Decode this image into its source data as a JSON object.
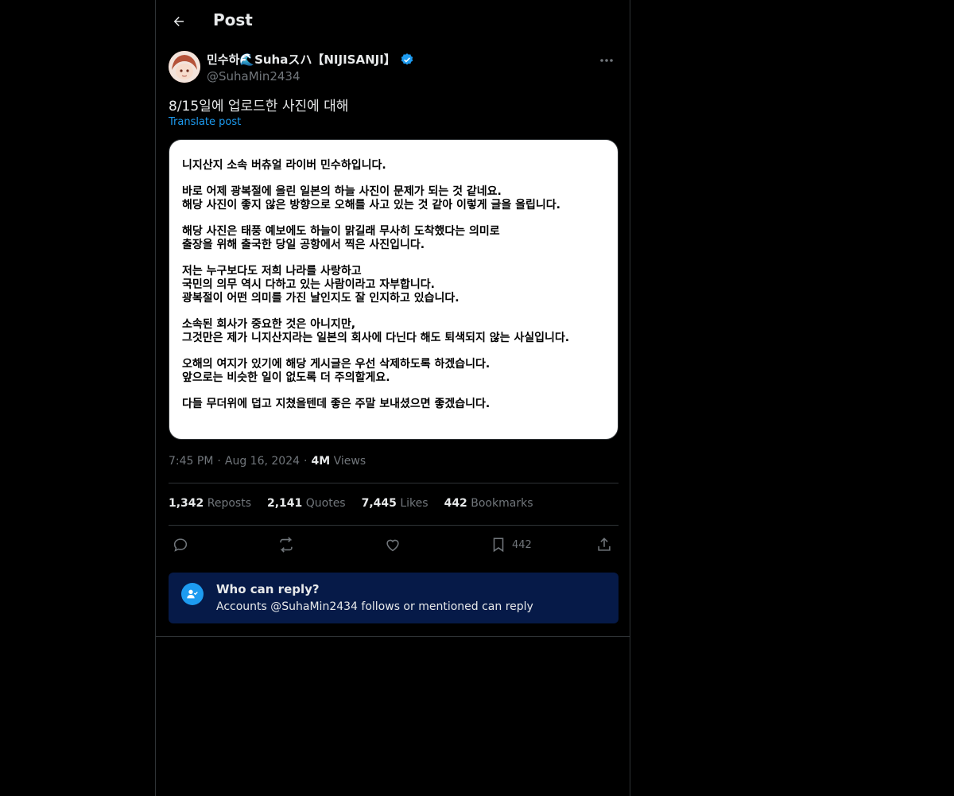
{
  "header": {
    "title": "Post"
  },
  "author": {
    "display_name": "민수하🌊Suhaスハ【NIJISANJI】",
    "handle": "@SuhaMin2434"
  },
  "post": {
    "text": "8/15일에 업로드한 사진에 대해",
    "translate_label": "Translate post",
    "image_paragraphs": [
      "니지산지 소속 버츄얼 라이버 민수하입니다.",
      "바로 어제 광복절에 올린 일본의 하늘 사진이 문제가 되는 것 같네요.\n해당 사진이 좋지 않은 방향으로 오해를 사고 있는 것 같아 이렇게 글을 올립니다.",
      "해당 사진은 태풍 예보에도 하늘이 맑길래 무사히 도착했다는 의미로\n출장을 위해 출국한 당일 공항에서 찍은 사진입니다.",
      "저는 누구보다도 저희 나라를 사랑하고\n국민의 의무 역시 다하고 있는 사람이라고 자부합니다.\n광복절이 어떤 의미를 가진 날인지도 잘 인지하고 있습니다.",
      "소속된 회사가 중요한 것은 아니지만,\n그것만은 제가 니지산지라는 일본의 회사에 다닌다 해도 퇴색되지 않는 사실입니다.",
      "오해의 여지가 있기에 해당 게시글은 우선 삭제하도록 하겠습니다.\n앞으로는 비슷한 일이 없도록 더 주의할게요.",
      "다들 무더위에 덥고 지쳤을텐데 좋은 주말 보내셨으면 좋겠습니다."
    ],
    "time": "7:45 PM",
    "date": "Aug 16, 2024",
    "views_value": "4M",
    "views_label": "Views"
  },
  "stats": {
    "reposts_value": "1,342",
    "reposts_label": "Reposts",
    "quotes_value": "2,141",
    "quotes_label": "Quotes",
    "likes_value": "7,445",
    "likes_label": "Likes",
    "bookmarks_value": "442",
    "bookmarks_label": "Bookmarks"
  },
  "actions": {
    "bookmark_count": "442"
  },
  "reply_box": {
    "title": "Who can reply?",
    "subtitle": "Accounts @SuhaMin2434 follows or mentioned can reply"
  },
  "colors": {
    "accent": "#1d9bf0",
    "reply_bg": "#061a48",
    "verified": "#1d9bf0"
  },
  "icons": [
    "back-arrow-icon",
    "verified-badge-icon",
    "more-icon",
    "reply-icon",
    "repost-icon",
    "like-icon",
    "bookmark-icon",
    "share-icon",
    "person-check-icon"
  ]
}
